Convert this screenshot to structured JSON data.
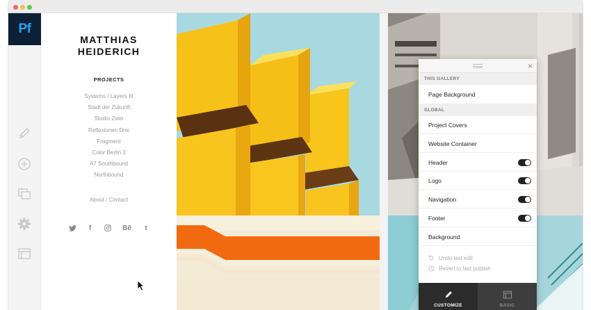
{
  "app": {
    "logo_text": "Pf",
    "tools": [
      "pencil-icon",
      "add-circle-icon",
      "pages-icon",
      "gear-icon",
      "layout-icon"
    ]
  },
  "site": {
    "title_line1": "MATTHIAS",
    "title_line2": "HEIDERICH",
    "projects_heading": "PROJECTS",
    "projects": [
      "Systems / Layers III",
      "Stadt der Zukunft",
      "Studio Zwei",
      "Reflexionen Drei",
      "Fragment",
      "Color Berlin 3",
      "A7 Southbound",
      "Northbound"
    ],
    "about_link": "About / Contact",
    "social": [
      "twitter-icon",
      "facebook-icon",
      "instagram-icon",
      "behance-icon",
      "tumblr-icon"
    ],
    "behance_text": "Bē",
    "tumblr_text": "t",
    "facebook_text": "f"
  },
  "panel": {
    "section_gallery": "THIS GALLERY",
    "page_background": "Page Background",
    "section_global": "GLOBAL",
    "items": [
      {
        "label": "Project Covers",
        "toggle": false
      },
      {
        "label": "Website Container",
        "toggle": false
      },
      {
        "label": "Header",
        "toggle": true
      },
      {
        "label": "Logo",
        "toggle": true
      },
      {
        "label": "Navigation",
        "toggle": true
      },
      {
        "label": "Footer",
        "toggle": true
      },
      {
        "label": "Background",
        "toggle": false
      }
    ],
    "undo": "Undo last edit",
    "revert": "Revert to last publish",
    "close_glyph": "×",
    "tabs": {
      "customize": "CUSTOMIZE",
      "basic": "BASIC"
    }
  },
  "colors": {
    "logo_bg": "#0c2136",
    "logo_text": "#2da0f0",
    "sky": "#a8d8df",
    "yellow": "#f6c418",
    "orange": "#f26a10"
  }
}
